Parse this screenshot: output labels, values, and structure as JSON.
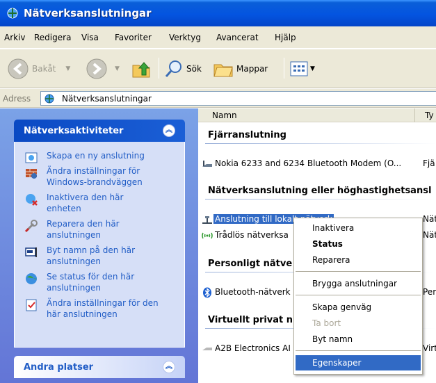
{
  "window": {
    "title": "Nätverksanslutningar"
  },
  "menu": [
    "Arkiv",
    "Redigera",
    "Visa",
    "Favoriter",
    "Verktyg",
    "Avancerat",
    "Hjälp"
  ],
  "toolbar": {
    "back": "Bakåt",
    "search": "Sök",
    "folders": "Mappar"
  },
  "address": {
    "label": "Adress",
    "value": "Nätverksanslutningar"
  },
  "tasks_panel": {
    "title": "Nätverksaktiviteter",
    "items": [
      [
        "Skapa en ny anslutning"
      ],
      [
        "Ändra inställningar för",
        "Windows-brandväggen"
      ],
      [
        "Inaktivera den här",
        "enheten"
      ],
      [
        "Reparera den här",
        "anslutningen"
      ],
      [
        "Byt namn på den här",
        "anslutningen"
      ],
      [
        "Se status för den här",
        "anslutningen"
      ],
      [
        "Ändra inställningar för den",
        "här anslutningen"
      ]
    ]
  },
  "places_panel": {
    "title": "Andra platser"
  },
  "columns": {
    "name": "Namn",
    "type": "Ty"
  },
  "groups": {
    "dialup": "Fjärranslutning",
    "lan": "Nätverksanslutning eller höghastighetsansl",
    "pan": "Personligt nätve",
    "vpn": "Virtuellt privat n"
  },
  "rows": {
    "nokia": {
      "name": "Nokia 6233 and 6234 Bluetooth Modem (O...",
      "type": "Fjä"
    },
    "lan": {
      "name": "Anslutning till lokalt nätverk",
      "type": "Nät"
    },
    "wifi": {
      "name": "Trådlös nätverksa",
      "type": "Nät"
    },
    "bt": {
      "name": "Bluetooth-nätverk",
      "type": "Per"
    },
    "vpn": {
      "name": "A2B Electronics AI",
      "type": "Virt"
    }
  },
  "context_menu": {
    "disable": "Inaktivera",
    "status": "Status",
    "repair": "Reparera",
    "bridge": "Brygga anslutningar",
    "shortcut": "Skapa genväg",
    "delete": "Ta bort",
    "rename": "Byt namn",
    "properties": "Egenskaper"
  }
}
